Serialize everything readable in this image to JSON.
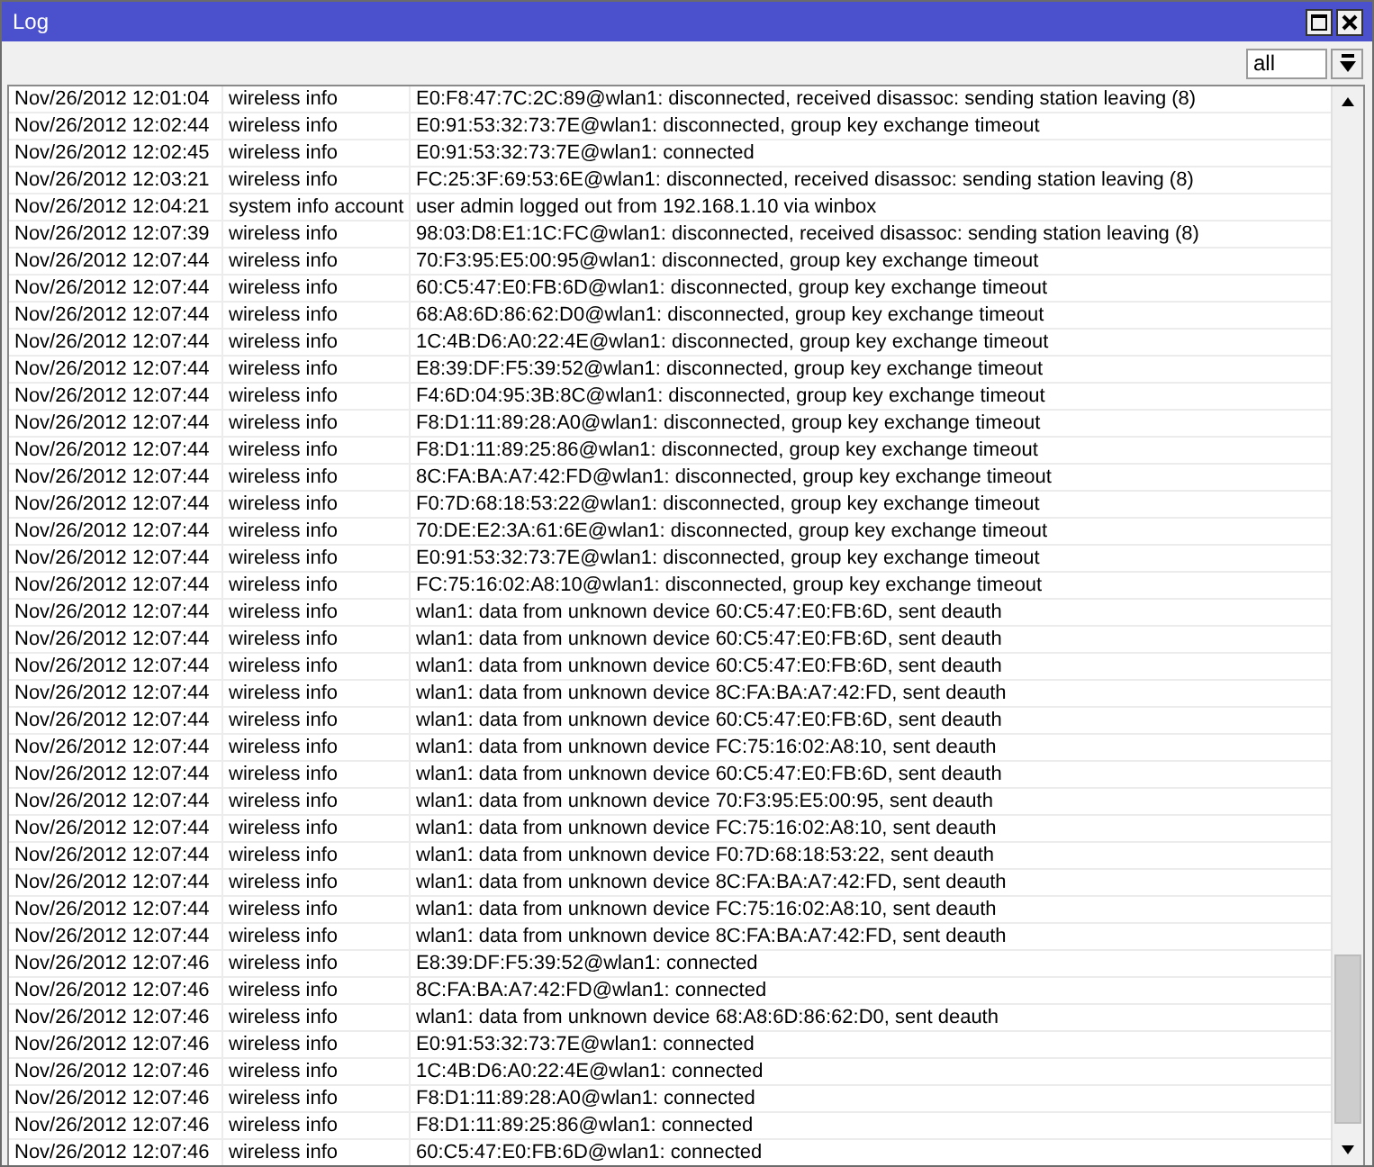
{
  "window": {
    "title": "Log"
  },
  "filter": {
    "value": "all"
  },
  "rows": [
    {
      "time": "Nov/26/2012 12:01:04",
      "topics": "wireless info",
      "message": "E0:F8:47:7C:2C:89@wlan1: disconnected, received disassoc: sending station leaving (8)"
    },
    {
      "time": "Nov/26/2012 12:02:44",
      "topics": "wireless info",
      "message": "E0:91:53:32:73:7E@wlan1: disconnected, group key exchange timeout"
    },
    {
      "time": "Nov/26/2012 12:02:45",
      "topics": "wireless info",
      "message": "E0:91:53:32:73:7E@wlan1: connected"
    },
    {
      "time": "Nov/26/2012 12:03:21",
      "topics": "wireless info",
      "message": "FC:25:3F:69:53:6E@wlan1: disconnected, received disassoc: sending station leaving (8)"
    },
    {
      "time": "Nov/26/2012 12:04:21",
      "topics": "system info account",
      "message": "user admin logged out from 192.168.1.10 via winbox"
    },
    {
      "time": "Nov/26/2012 12:07:39",
      "topics": "wireless info",
      "message": "98:03:D8:E1:1C:FC@wlan1: disconnected, received disassoc: sending station leaving (8)"
    },
    {
      "time": "Nov/26/2012 12:07:44",
      "topics": "wireless info",
      "message": "70:F3:95:E5:00:95@wlan1: disconnected, group key exchange timeout"
    },
    {
      "time": "Nov/26/2012 12:07:44",
      "topics": "wireless info",
      "message": "60:C5:47:E0:FB:6D@wlan1: disconnected, group key exchange timeout"
    },
    {
      "time": "Nov/26/2012 12:07:44",
      "topics": "wireless info",
      "message": "68:A8:6D:86:62:D0@wlan1: disconnected, group key exchange timeout"
    },
    {
      "time": "Nov/26/2012 12:07:44",
      "topics": "wireless info",
      "message": "1C:4B:D6:A0:22:4E@wlan1: disconnected, group key exchange timeout"
    },
    {
      "time": "Nov/26/2012 12:07:44",
      "topics": "wireless info",
      "message": "E8:39:DF:F5:39:52@wlan1: disconnected, group key exchange timeout"
    },
    {
      "time": "Nov/26/2012 12:07:44",
      "topics": "wireless info",
      "message": "F4:6D:04:95:3B:8C@wlan1: disconnected, group key exchange timeout"
    },
    {
      "time": "Nov/26/2012 12:07:44",
      "topics": "wireless info",
      "message": "F8:D1:11:89:28:A0@wlan1: disconnected, group key exchange timeout"
    },
    {
      "time": "Nov/26/2012 12:07:44",
      "topics": "wireless info",
      "message": "F8:D1:11:89:25:86@wlan1: disconnected, group key exchange timeout"
    },
    {
      "time": "Nov/26/2012 12:07:44",
      "topics": "wireless info",
      "message": "8C:FA:BA:A7:42:FD@wlan1: disconnected, group key exchange timeout"
    },
    {
      "time": "Nov/26/2012 12:07:44",
      "topics": "wireless info",
      "message": "F0:7D:68:18:53:22@wlan1: disconnected, group key exchange timeout"
    },
    {
      "time": "Nov/26/2012 12:07:44",
      "topics": "wireless info",
      "message": "70:DE:E2:3A:61:6E@wlan1: disconnected, group key exchange timeout"
    },
    {
      "time": "Nov/26/2012 12:07:44",
      "topics": "wireless info",
      "message": "E0:91:53:32:73:7E@wlan1: disconnected, group key exchange timeout"
    },
    {
      "time": "Nov/26/2012 12:07:44",
      "topics": "wireless info",
      "message": "FC:75:16:02:A8:10@wlan1: disconnected, group key exchange timeout"
    },
    {
      "time": "Nov/26/2012 12:07:44",
      "topics": "wireless info",
      "message": "wlan1: data from unknown device 60:C5:47:E0:FB:6D, sent deauth"
    },
    {
      "time": "Nov/26/2012 12:07:44",
      "topics": "wireless info",
      "message": "wlan1: data from unknown device 60:C5:47:E0:FB:6D, sent deauth"
    },
    {
      "time": "Nov/26/2012 12:07:44",
      "topics": "wireless info",
      "message": "wlan1: data from unknown device 60:C5:47:E0:FB:6D, sent deauth"
    },
    {
      "time": "Nov/26/2012 12:07:44",
      "topics": "wireless info",
      "message": "wlan1: data from unknown device 8C:FA:BA:A7:42:FD, sent deauth"
    },
    {
      "time": "Nov/26/2012 12:07:44",
      "topics": "wireless info",
      "message": "wlan1: data from unknown device 60:C5:47:E0:FB:6D, sent deauth"
    },
    {
      "time": "Nov/26/2012 12:07:44",
      "topics": "wireless info",
      "message": "wlan1: data from unknown device FC:75:16:02:A8:10, sent deauth"
    },
    {
      "time": "Nov/26/2012 12:07:44",
      "topics": "wireless info",
      "message": "wlan1: data from unknown device 60:C5:47:E0:FB:6D, sent deauth"
    },
    {
      "time": "Nov/26/2012 12:07:44",
      "topics": "wireless info",
      "message": "wlan1: data from unknown device 70:F3:95:E5:00:95, sent deauth"
    },
    {
      "time": "Nov/26/2012 12:07:44",
      "topics": "wireless info",
      "message": "wlan1: data from unknown device FC:75:16:02:A8:10, sent deauth"
    },
    {
      "time": "Nov/26/2012 12:07:44",
      "topics": "wireless info",
      "message": "wlan1: data from unknown device F0:7D:68:18:53:22, sent deauth"
    },
    {
      "time": "Nov/26/2012 12:07:44",
      "topics": "wireless info",
      "message": "wlan1: data from unknown device 8C:FA:BA:A7:42:FD, sent deauth"
    },
    {
      "time": "Nov/26/2012 12:07:44",
      "topics": "wireless info",
      "message": "wlan1: data from unknown device FC:75:16:02:A8:10, sent deauth"
    },
    {
      "time": "Nov/26/2012 12:07:44",
      "topics": "wireless info",
      "message": "wlan1: data from unknown device 8C:FA:BA:A7:42:FD, sent deauth"
    },
    {
      "time": "Nov/26/2012 12:07:46",
      "topics": "wireless info",
      "message": "E8:39:DF:F5:39:52@wlan1: connected"
    },
    {
      "time": "Nov/26/2012 12:07:46",
      "topics": "wireless info",
      "message": "8C:FA:BA:A7:42:FD@wlan1: connected"
    },
    {
      "time": "Nov/26/2012 12:07:46",
      "topics": "wireless info",
      "message": "wlan1: data from unknown device 68:A8:6D:86:62:D0, sent deauth"
    },
    {
      "time": "Nov/26/2012 12:07:46",
      "topics": "wireless info",
      "message": "E0:91:53:32:73:7E@wlan1: connected"
    },
    {
      "time": "Nov/26/2012 12:07:46",
      "topics": "wireless info",
      "message": "1C:4B:D6:A0:22:4E@wlan1: connected"
    },
    {
      "time": "Nov/26/2012 12:07:46",
      "topics": "wireless info",
      "message": "F8:D1:11:89:28:A0@wlan1: connected"
    },
    {
      "time": "Nov/26/2012 12:07:46",
      "topics": "wireless info",
      "message": "F8:D1:11:89:25:86@wlan1: connected"
    },
    {
      "time": "Nov/26/2012 12:07:46",
      "topics": "wireless info",
      "message": "60:C5:47:E0:FB:6D@wlan1: connected"
    }
  ]
}
